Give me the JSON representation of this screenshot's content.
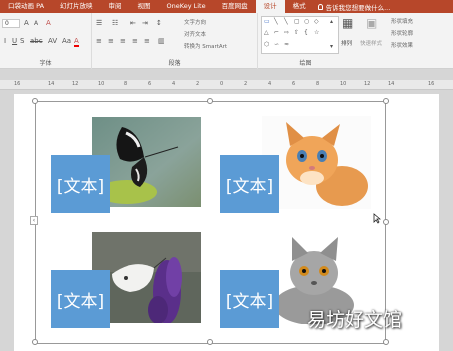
{
  "tabs": [
    {
      "label": "口袋动画 PA",
      "active": false
    },
    {
      "label": "幻灯片放映",
      "active": false
    },
    {
      "label": "审阅",
      "active": false
    },
    {
      "label": "视图",
      "active": false
    },
    {
      "label": "OneKey Lite",
      "active": false
    },
    {
      "label": "百度网盘",
      "active": false
    },
    {
      "label": "设计",
      "active": true
    },
    {
      "label": "格式",
      "active": false
    }
  ],
  "tell_me": "告诉我您想要做什么...",
  "ribbon": {
    "font_size_value": "0",
    "font_group_label": "字体",
    "paragraph_group_label": "段落",
    "drawing_group_label": "绘图",
    "text_direction": "文字方向",
    "align_text": "对齐文本",
    "convert_smartart": "转换为 SmartArt",
    "arrange": "排列",
    "quick_styles": "快速样式",
    "shape_fill": "形状填充",
    "shape_outline": "形状轮廓",
    "shape_effects": "形状效果"
  },
  "ruler": {
    "labels": [
      "16",
      "14",
      "12",
      "10",
      "8",
      "6",
      "4",
      "2",
      "0",
      "2",
      "4",
      "6",
      "8",
      "10",
      "12",
      "14",
      "16"
    ]
  },
  "slide": {
    "boxes": [
      {
        "text": "[文本]"
      },
      {
        "text": "[文本]"
      },
      {
        "text": "[文本]"
      },
      {
        "text": "[文本]"
      }
    ]
  },
  "watermark": "易坊好文馆",
  "colors": {
    "accent": "#b7472a",
    "textbox": "#5b9bd5"
  }
}
